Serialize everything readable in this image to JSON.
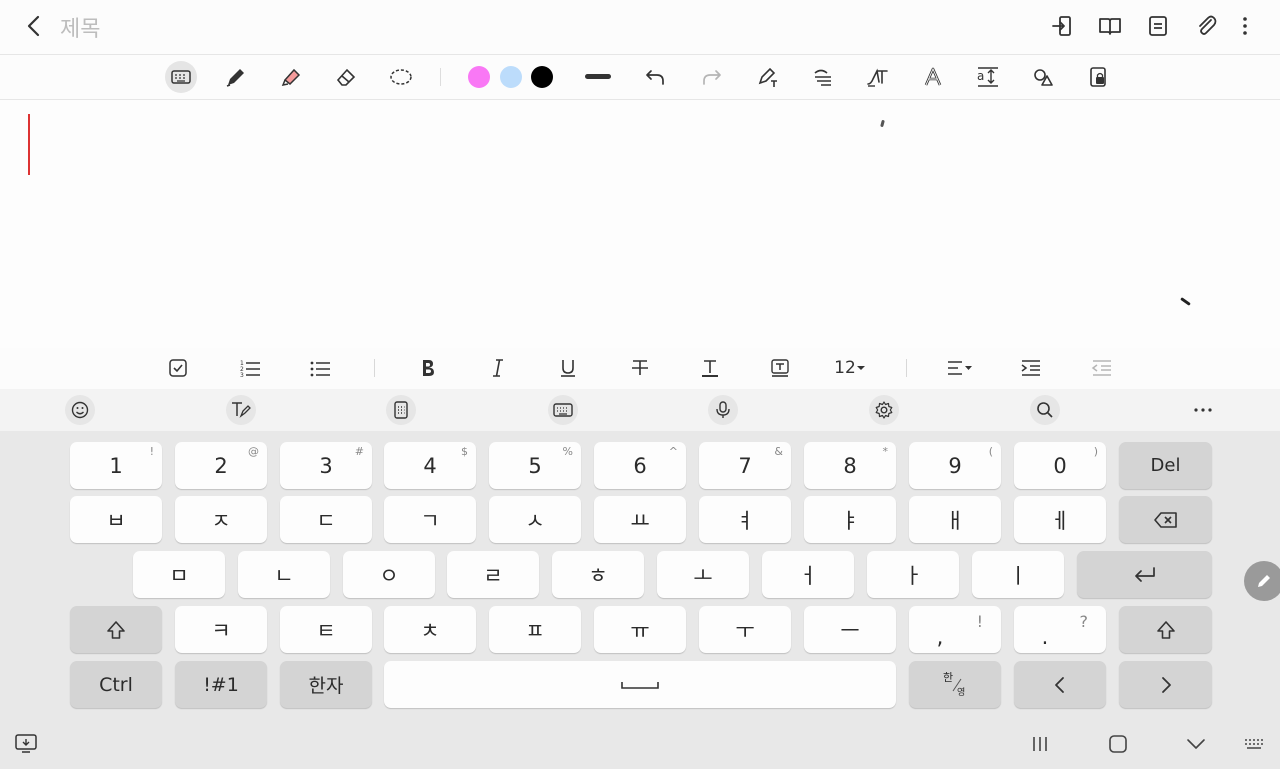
{
  "header": {
    "title_placeholder": "제목"
  },
  "toolbar": {
    "colors": [
      "#f978f5",
      "#bcdcfb",
      "#000000"
    ]
  },
  "format_bar": {
    "font_size": "12"
  },
  "keyboard": {
    "row1": [
      {
        "main": "1",
        "sub": "!"
      },
      {
        "main": "2",
        "sub": "@"
      },
      {
        "main": "3",
        "sub": "#"
      },
      {
        "main": "4",
        "sub": "$"
      },
      {
        "main": "5",
        "sub": "%"
      },
      {
        "main": "6",
        "sub": "^"
      },
      {
        "main": "7",
        "sub": "&"
      },
      {
        "main": "8",
        "sub": "*"
      },
      {
        "main": "9",
        "sub": "("
      },
      {
        "main": "0",
        "sub": ")"
      }
    ],
    "del_label": "Del",
    "row2": [
      "ㅂ",
      "ㅈ",
      "ㄷ",
      "ㄱ",
      "ㅅ",
      "ㅛ",
      "ㅕ",
      "ㅑ",
      "ㅐ",
      "ㅔ"
    ],
    "row3": [
      "ㅁ",
      "ㄴ",
      "ㅇ",
      "ㄹ",
      "ㅎ",
      "ㅗ",
      "ㅓ",
      "ㅏ",
      "ㅣ"
    ],
    "row4": [
      "ㅋ",
      "ㅌ",
      "ㅊ",
      "ㅍ",
      "ㅠ",
      "ㅜ",
      "ㅡ"
    ],
    "comma_key": {
      "main": ",",
      "sub": "!"
    },
    "period_key": {
      "main": ".",
      "sub": "?"
    },
    "ctrl_label": "Ctrl",
    "symbols_label": "!#1",
    "hanja_label": "한자",
    "lang_top": "한",
    "lang_bottom": "영"
  }
}
